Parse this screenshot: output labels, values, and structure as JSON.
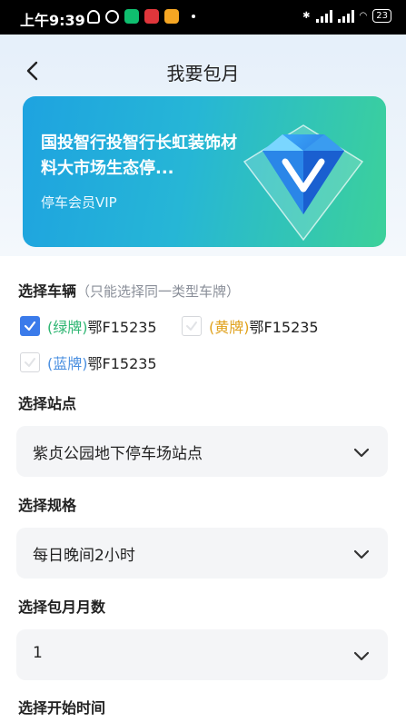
{
  "status_bar": {
    "time": "上午9:39",
    "battery": "23"
  },
  "header": {
    "title": "我要包月"
  },
  "banner": {
    "title": "国投智行投智行长虹装饰材料大市场生态停...",
    "subtitle": "停车会员VIP"
  },
  "vehicle_section": {
    "label": "选择车辆",
    "hint": "（只能选择同一类型车牌）",
    "vehicles": [
      {
        "type": "(绿牌)",
        "plate": "鄂F15235",
        "checked": true
      },
      {
        "type": "(黄牌)",
        "plate": "鄂F15235",
        "checked": false
      },
      {
        "type": "(蓝牌)",
        "plate": "鄂F15235",
        "checked": false
      }
    ]
  },
  "station_section": {
    "label": "选择站点",
    "value": "紫贞公园地下停车场站点"
  },
  "spec_section": {
    "label": "选择规格",
    "value": "每日晚间2小时"
  },
  "months_section": {
    "label": "选择包月月数",
    "value": "1"
  },
  "start_section": {
    "label": "选择开始时间"
  },
  "colors": {
    "accent": "#3b7bea",
    "green_plate": "#2fb673",
    "yellow_plate": "#e0a11c",
    "blue_plate": "#4a8fe0"
  }
}
